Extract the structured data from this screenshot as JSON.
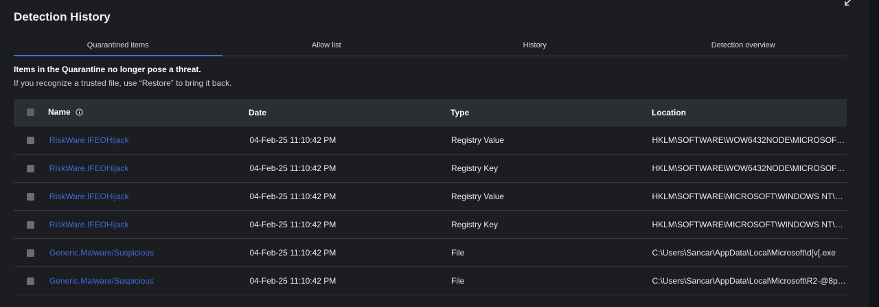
{
  "title": "Detection History",
  "tabs": [
    {
      "label": "Quarantined items",
      "active": true
    },
    {
      "label": "Allow list",
      "active": false
    },
    {
      "label": "History",
      "active": false
    },
    {
      "label": "Detection overview",
      "active": false
    }
  ],
  "notice": {
    "headline": "Items in the Quarantine no longer pose a threat.",
    "subtext": "If you recognize a trusted file, use “Restore” to bring it back."
  },
  "table": {
    "columns": {
      "name": "Name",
      "date": "Date",
      "type": "Type",
      "location": "Location"
    },
    "rows": [
      {
        "name": "RiskWare.IFEOHijack",
        "date": "04-Feb-25 11:10:42 PM",
        "type": "Registry Value",
        "location": "HKLM\\SOFTWARE\\WOW6432NODE\\MICROSOFT\\WI..."
      },
      {
        "name": "RiskWare.IFEOHijack",
        "date": "04-Feb-25 11:10:42 PM",
        "type": "Registry Key",
        "location": "HKLM\\SOFTWARE\\WOW6432NODE\\MICROSOFT\\WI..."
      },
      {
        "name": "RiskWare.IFEOHijack",
        "date": "04-Feb-25 11:10:42 PM",
        "type": "Registry Value",
        "location": "HKLM\\SOFTWARE\\MICROSOFT\\WINDOWS NT\\CUR..."
      },
      {
        "name": "RiskWare.IFEOHijack",
        "date": "04-Feb-25 11:10:42 PM",
        "type": "Registry Key",
        "location": "HKLM\\SOFTWARE\\MICROSOFT\\WINDOWS NT\\CUR..."
      },
      {
        "name": "Generic.Malware/Suspicious",
        "date": "04-Feb-25 11:10:42 PM",
        "type": "File",
        "location": "C:\\Users\\Sancar\\AppData\\Local\\Microsoft\\d[v[.exe"
      },
      {
        "name": "Generic.Malware/Suspicious",
        "date": "04-Feb-25 11:10:42 PM",
        "type": "File",
        "location": "C:\\Users\\Sancar\\AppData\\Local\\Microsoft\\R2-@8pk..."
      }
    ]
  },
  "colors": {
    "background": "#1c1d21",
    "header_row": "#2b2e35",
    "accent": "#3f6fd8",
    "link": "#3d6bd6"
  },
  "icons": {
    "expand": "collapse-arrow-icon",
    "info": "info-circle-icon"
  }
}
